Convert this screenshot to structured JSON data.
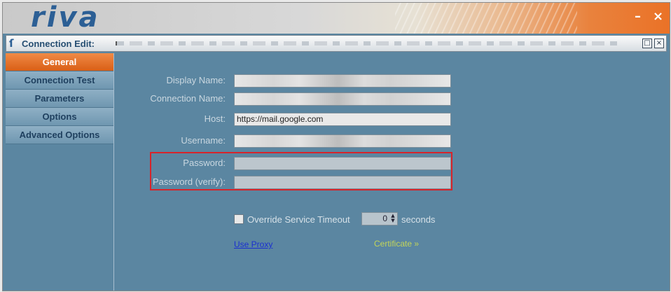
{
  "app": {
    "logo": "riva"
  },
  "window_controls": {
    "minimize": "–",
    "close": "×"
  },
  "titlebar": {
    "title": "Connection Edit:",
    "restore": "□",
    "close": "×"
  },
  "sidebar": {
    "items": [
      {
        "label": "General",
        "active": true
      },
      {
        "label": "Connection Test",
        "active": false
      },
      {
        "label": "Parameters",
        "active": false
      },
      {
        "label": "Options",
        "active": false
      },
      {
        "label": "Advanced Options",
        "active": false
      }
    ]
  },
  "form": {
    "display_name": {
      "label": "Display Name:",
      "value": ""
    },
    "connection_name": {
      "label": "Connection Name:",
      "value": ""
    },
    "host": {
      "label": "Host:",
      "value": "https://mail.google.com"
    },
    "username": {
      "label": "Username:",
      "value": ""
    },
    "password": {
      "label": "Password:",
      "value": ""
    },
    "password_verify": {
      "label": "Password (verify):",
      "value": ""
    },
    "override_timeout": {
      "label": "Override Service Timeout",
      "checked": false
    },
    "timeout_value": "0",
    "timeout_unit": "seconds",
    "use_proxy": "Use Proxy",
    "certificate": "Certificate »"
  },
  "colors": {
    "accent": "#e0661f",
    "panel": "#5b86a1",
    "highlight": "#d7242a"
  }
}
